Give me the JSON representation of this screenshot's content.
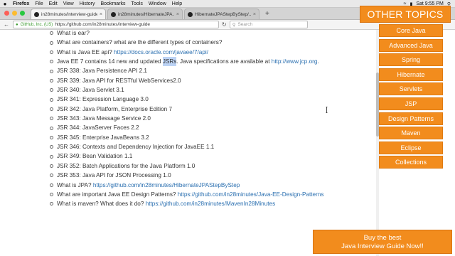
{
  "menubar": {
    "apple": "",
    "items": [
      "Firefox",
      "File",
      "Edit",
      "View",
      "History",
      "Bookmarks",
      "Tools",
      "Window",
      "Help"
    ],
    "clock": "Sat 9:55 PM"
  },
  "tabs": [
    {
      "label": "in28minutes/interview-guide"
    },
    {
      "label": "in28minutes/HibernateJPA..."
    },
    {
      "label": "HibernateJPAStepByStep/..."
    }
  ],
  "navbar": {
    "site_identity": "GitHub, Inc. (US)",
    "url": "https://github.com/in28minutes/interview-guide",
    "search_placeholder": "Search"
  },
  "content": {
    "items": [
      {
        "text": "What is ear?"
      },
      {
        "text": "What are containers? what are the different types of containers?"
      },
      {
        "text": "What is Java EE api? ",
        "link": "https://docs.oracle.com/javaee/7/api/"
      },
      {
        "pre": "Java EE 7 contains 14 new and updated ",
        "highlight": "JSRs",
        "post": ". Java specifications are available at ",
        "link": "http://www.jcp.org",
        "tail": "."
      },
      {
        "text": "JSR 338: Java Persistence API 2.1"
      },
      {
        "text": "JSR 339: Java API for RESTful WebServices2.0"
      },
      {
        "text": "JSR 340: Java Servlet 3.1"
      },
      {
        "text": "JSR 341: Expression Language 3.0"
      },
      {
        "text": "JSR 342: Java Platform, Enterprise Edition 7"
      },
      {
        "text": "JSR 343: Java Message Service 2.0"
      },
      {
        "text": "JSR 344: JavaServer Faces 2.2"
      },
      {
        "text": "JSR 345: Enterprise JavaBeans 3.2"
      },
      {
        "text": "JSR 346: Contexts and Dependency Injection for JavaEE 1.1"
      },
      {
        "text": "JSR 349: Bean Validation 1.1"
      },
      {
        "text": "JSR 352: Batch Applications for the Java Platform 1.0"
      },
      {
        "text": "JSR 353: Java API for JSON Processing 1.0"
      },
      {
        "text": "What is JPA? ",
        "link": "https://github.com/in28minutes/HibernateJPAStepByStep"
      },
      {
        "text": "What are important Java EE Design Patterns? ",
        "link": "https://github.com/in28minutes/Java-EE-Design-Patterns"
      },
      {
        "text": "What is maven? What does it do? ",
        "link": "https://github.com/in28minutes/MavenIn28Minutes"
      }
    ]
  },
  "sidebar": {
    "header": "OTHER TOPICS",
    "items": [
      "Core Java",
      "Advanced Java",
      "Spring",
      "Hibernate",
      "Servlets",
      "JSP",
      "Design Patterns",
      "Maven",
      "Eclipse",
      "Collections"
    ]
  },
  "promo": {
    "line1": "Buy the best",
    "line2": "Java Interview Guide Now!!"
  },
  "colors": {
    "accent_orange": "#f28c1d",
    "link_blue": "#2a6fb0",
    "highlight": "#bcd3f5"
  }
}
